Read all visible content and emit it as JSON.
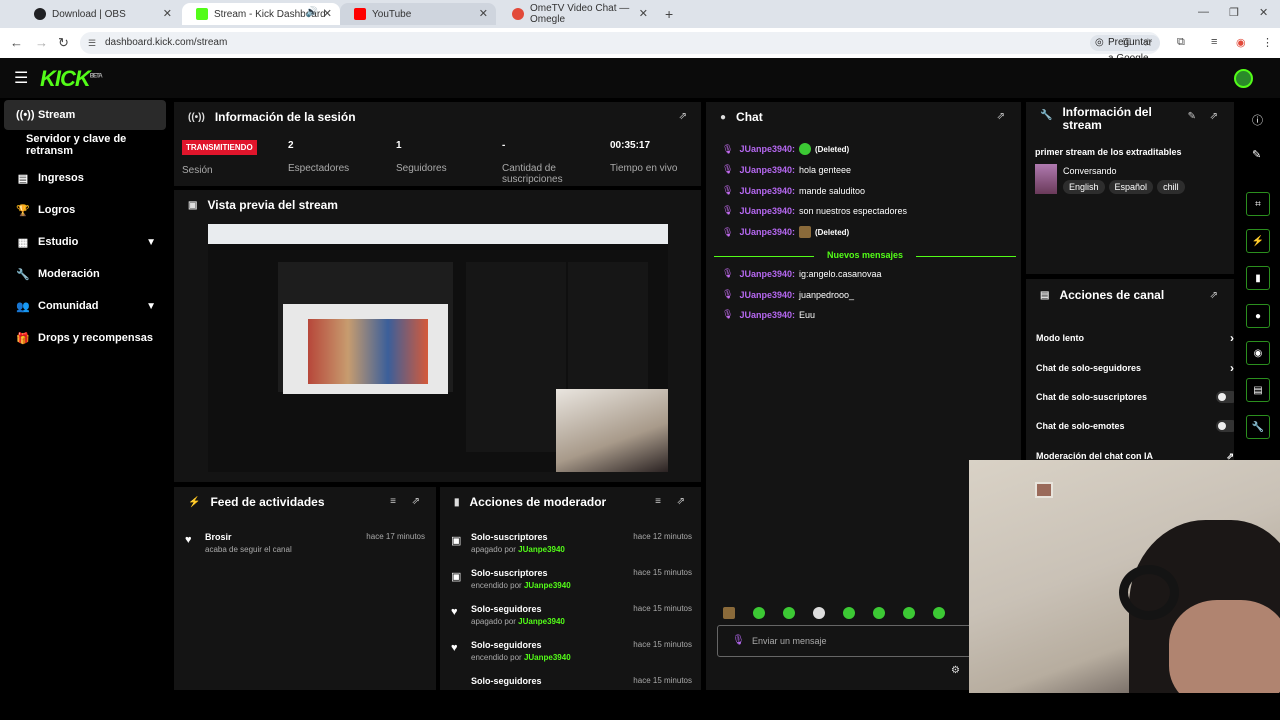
{
  "browser": {
    "tabs": [
      {
        "title": "Download | OBS",
        "color": "#202124"
      },
      {
        "title": "Stream - Kick Dashboard",
        "color": "#53fc18"
      },
      {
        "title": "YouTube",
        "color": "#ff0000"
      },
      {
        "title": "OmeTV Video Chat — Omegle",
        "color": "#e24a3a"
      }
    ],
    "url": "dashboard.kick.com/stream",
    "translate_label": "Preguntar a Google"
  },
  "kick": {
    "logo": "KICK",
    "beta": "BETA"
  },
  "sidebar": {
    "items": [
      {
        "label": "Stream",
        "icon": "radio-icon"
      },
      {
        "label": "Servidor y clave de retransm"
      },
      {
        "label": "Ingresos",
        "icon": "chart-icon"
      },
      {
        "label": "Logros",
        "icon": "trophy-icon"
      },
      {
        "label": "Estudio",
        "icon": "studio-icon"
      },
      {
        "label": "Moderación",
        "icon": "wrench-icon"
      },
      {
        "label": "Comunidad",
        "icon": "people-icon"
      },
      {
        "label": "Drops y recompensas",
        "icon": "gift-icon"
      }
    ]
  },
  "session": {
    "title": "Información de la sesión",
    "live_badge": "TRANSMITIENDO",
    "session_label": "Sesión",
    "stats": [
      {
        "value": "2",
        "label": "Espectadores"
      },
      {
        "value": "1",
        "label": "Seguidores"
      },
      {
        "value": "-",
        "label": "Cantidad de suscripciones"
      },
      {
        "value": "00:35:17",
        "label": "Tiempo en vivo"
      }
    ]
  },
  "preview": {
    "title": "Vista previa del stream"
  },
  "feed": {
    "title": "Feed de actividades",
    "items": [
      {
        "name": "Brosir",
        "sub": "acaba de seguir el canal",
        "time": "hace 17 minutos"
      }
    ]
  },
  "mod_actions": {
    "title": "Acciones de moderador",
    "items": [
      {
        "title": "Solo-suscriptores",
        "sub": "apagado por",
        "user": "JUanpe3940",
        "time": "hace 12 minutos"
      },
      {
        "title": "Solo-suscriptores",
        "sub": "encendido por",
        "user": "JUanpe3940",
        "time": "hace 15 minutos"
      },
      {
        "title": "Solo-seguidores",
        "sub": "apagado por",
        "user": "JUanpe3940",
        "time": "hace 15 minutos"
      },
      {
        "title": "Solo-seguidores",
        "sub": "encendido por",
        "user": "JUanpe3940",
        "time": "hace 15 minutos"
      },
      {
        "title": "Solo-seguidores",
        "sub": "",
        "user": "",
        "time": "hace 15 minutos"
      }
    ]
  },
  "chat": {
    "title": "Chat",
    "messages": [
      {
        "user": "JUanpe3940:",
        "text": "(Deleted)",
        "emote": true
      },
      {
        "user": "JUanpe3940:",
        "text": "hola genteee"
      },
      {
        "user": "JUanpe3940:",
        "text": "mande saluditoo"
      },
      {
        "user": "JUanpe3940:",
        "text": "son nuestros espectadores"
      },
      {
        "user": "JUanpe3940:",
        "text": "(Deleted)",
        "emote": true
      }
    ],
    "new_label": "Nuevos mensajes",
    "new_messages": [
      {
        "user": "JUanpe3940:",
        "text": "ig:angelo.casanovaa"
      },
      {
        "user": "JUanpe3940:",
        "text": "juanpedrooo_"
      },
      {
        "user": "JUanpe3940:",
        "text": "Euu"
      }
    ],
    "input_placeholder": "Enviar un mensaje"
  },
  "stream_info": {
    "title": "Información del stream",
    "stream_title": "primer stream de los extraditables",
    "category": "Conversando",
    "tags": [
      "English",
      "Español",
      "chill"
    ]
  },
  "channel_actions": {
    "title": "Acciones de canal",
    "items": [
      {
        "label": "Modo lento",
        "type": "arrow"
      },
      {
        "label": "Chat de solo-seguidores",
        "type": "arrow"
      },
      {
        "label": "Chat de solo-suscriptores",
        "type": "toggle"
      },
      {
        "label": "Chat de solo-emotes",
        "type": "toggle"
      },
      {
        "label": "Moderación del chat con IA",
        "type": "link"
      }
    ]
  },
  "colors": {
    "accent": "#53fc18",
    "live": "#e0152b",
    "username": "#b568f0"
  }
}
